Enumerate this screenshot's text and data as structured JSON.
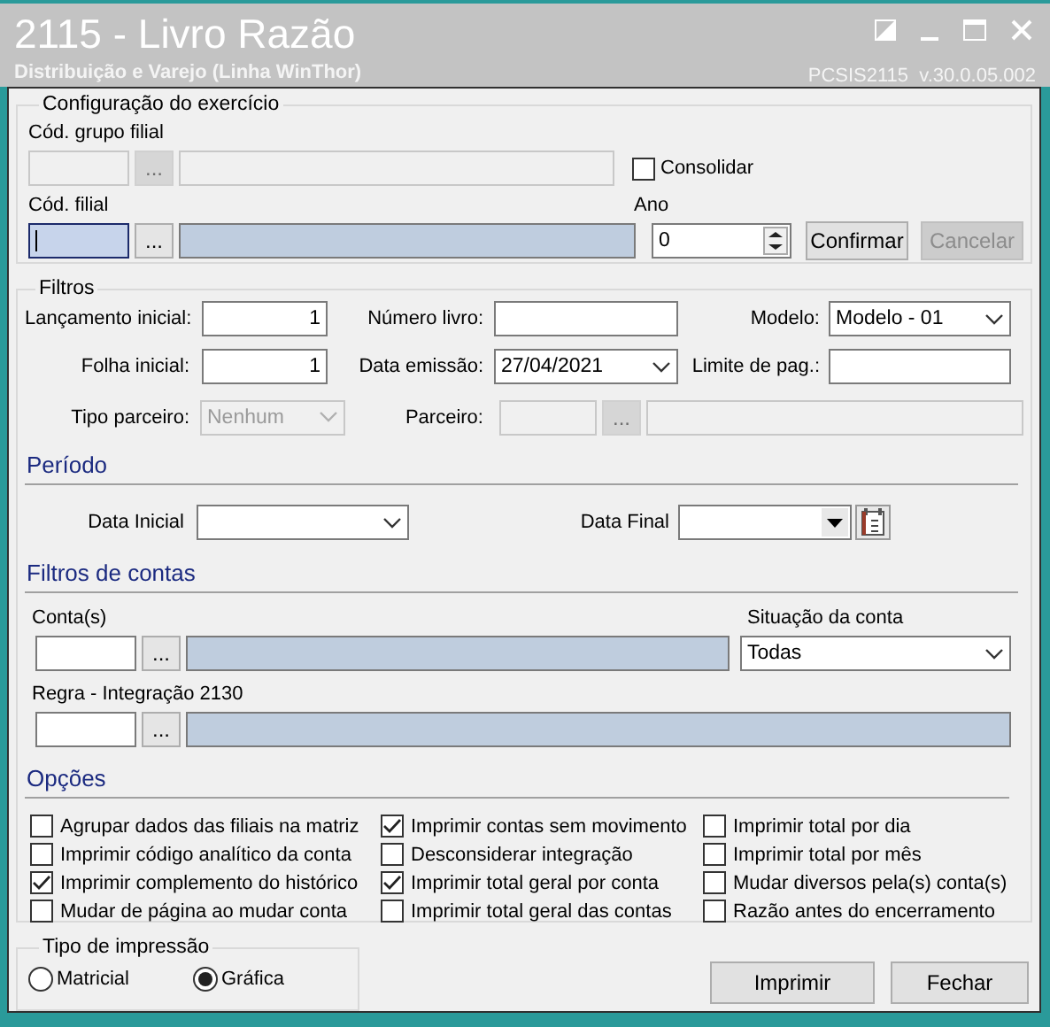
{
  "window": {
    "title": "2115 - Livro Razão",
    "subtitle": "Distribuição e Varejo (Linha WinThor)",
    "version": "PCSIS2115  v.30.0.05.002"
  },
  "exercicio": {
    "title": "Configuração do exercício",
    "grupo": {
      "label": "Cód. grupo filial",
      "button": "...",
      "disabled": true
    },
    "consolidar": {
      "label": "Consolidar",
      "checked": false
    },
    "filial": {
      "label": "Cód. filial",
      "button": "...",
      "disabled": false
    },
    "ano": {
      "label": "Ano",
      "value": "0"
    },
    "buttons": [
      {
        "label": "Confirmar",
        "disabled": false
      },
      {
        "label": "Cancelar",
        "disabled": true
      }
    ]
  },
  "filtros": {
    "title": "Filtros",
    "lancamento": {
      "label": "Lançamento inicial:",
      "value": "1"
    },
    "numero_livro": {
      "label": "Número livro:"
    },
    "modelo": {
      "label": "Modelo:",
      "value": "Modelo - 01"
    },
    "folha": {
      "label": "Folha inicial:",
      "value": "1"
    },
    "data_emissao": {
      "label": "Data emissão:",
      "value": "27/04/2021"
    },
    "limite": {
      "label": "Limite de pag.:"
    },
    "tipo_parceiro": {
      "label": "Tipo parceiro:",
      "value": "Nenhum",
      "disabled": true
    },
    "parceiro": {
      "label": "Parceiro:",
      "button": "...",
      "disabled": true
    }
  },
  "periodo": {
    "title": "Período",
    "data_inicial": {
      "label": "Data Inicial"
    },
    "data_final": {
      "label": "Data Final"
    }
  },
  "contas": {
    "title": "Filtros de contas",
    "conta": {
      "label": "Conta(s)",
      "button": "...",
      "disabled": false
    },
    "situacao": {
      "label": "Situação da conta",
      "value": "Todas"
    },
    "regra": {
      "label": "Regra - Integração 2130",
      "button": "...",
      "disabled": false
    }
  },
  "opcoes": {
    "title": "Opções",
    "columns": [
      [
        {
          "label": "Agrupar dados das filiais na matriz",
          "checked": false
        },
        {
          "label": "Imprimir código analítico da conta",
          "checked": false
        },
        {
          "label": "Imprimir complemento do histórico",
          "checked": true
        },
        {
          "label": "Mudar de página ao mudar conta",
          "checked": false
        }
      ],
      [
        {
          "label": "Imprimir contas sem movimento",
          "checked": true
        },
        {
          "label": "Desconsiderar integração",
          "checked": false
        },
        {
          "label": "Imprimir total geral por conta",
          "checked": true
        },
        {
          "label": "Imprimir total geral das contas",
          "checked": false
        }
      ],
      [
        {
          "label": "Imprimir total por dia",
          "checked": false
        },
        {
          "label": "Imprimir total por mês",
          "checked": false
        },
        {
          "label": "Mudar diversos pela(s) conta(s)",
          "checked": false
        },
        {
          "label": "Razão antes do encerramento",
          "checked": false
        }
      ]
    ]
  },
  "tipo_impressao": {
    "title": "Tipo de impressão",
    "options": [
      {
        "label": "Matricial",
        "selected": false
      },
      {
        "label": "Gráfica",
        "selected": true
      }
    ]
  },
  "buttons": [
    {
      "label": "Imprimir"
    },
    {
      "label": "Fechar"
    }
  ]
}
